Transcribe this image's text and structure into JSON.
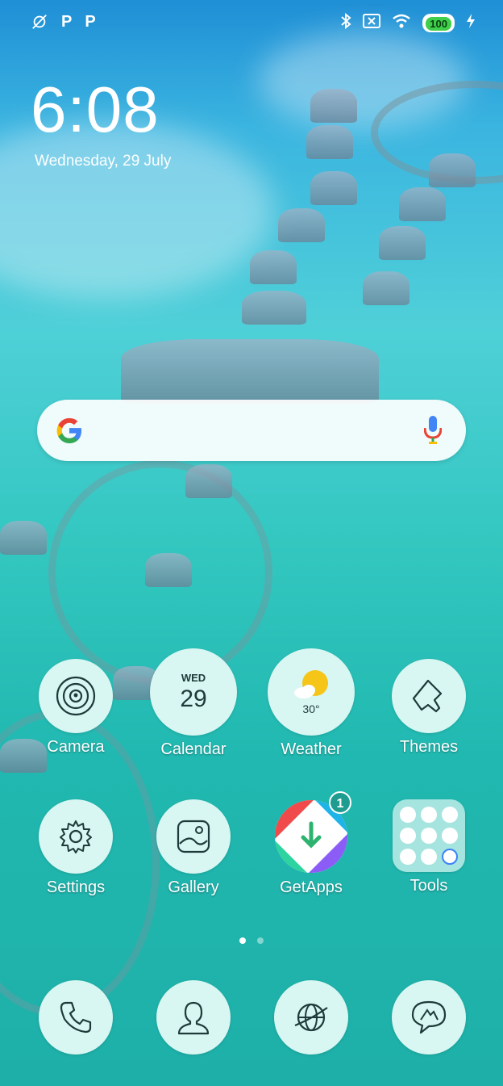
{
  "status_bar": {
    "left_icons": [
      "mute-alarm-icon",
      "P",
      "P"
    ],
    "right_icons": [
      "bluetooth-icon",
      "no-sim-icon",
      "wifi-icon"
    ],
    "battery": "100",
    "charging_icon": "bolt-icon"
  },
  "clock": {
    "time": "6:08",
    "date": "Wednesday, 29 July"
  },
  "search": {
    "logo": "google-icon",
    "mic": "mic-icon"
  },
  "apps": [
    {
      "label": "Camera",
      "icon": "camera-icon"
    },
    {
      "label": "Calendar",
      "icon": "calendar-icon",
      "day_name": "WED",
      "day_num": "29"
    },
    {
      "label": "Weather",
      "icon": "weather-sun-icon",
      "temp": "30°"
    },
    {
      "label": "Themes",
      "icon": "themes-brush-icon"
    },
    {
      "label": "Settings",
      "icon": "gear-icon"
    },
    {
      "label": "Gallery",
      "icon": "gallery-icon"
    },
    {
      "label": "GetApps",
      "icon": "getapps-icon",
      "badge": "1"
    },
    {
      "label": "Tools",
      "icon": "tools-folder-icon"
    }
  ],
  "page_indicator": {
    "pages": 2,
    "active": 0
  },
  "dock": [
    {
      "icon": "phone-icon"
    },
    {
      "icon": "contacts-icon"
    },
    {
      "icon": "browser-globe-icon"
    },
    {
      "icon": "messages-icon"
    }
  ],
  "colors": {
    "icon_bg": "#d8f6f2",
    "accent": "#1e9c8f",
    "text": "#ffffff"
  }
}
